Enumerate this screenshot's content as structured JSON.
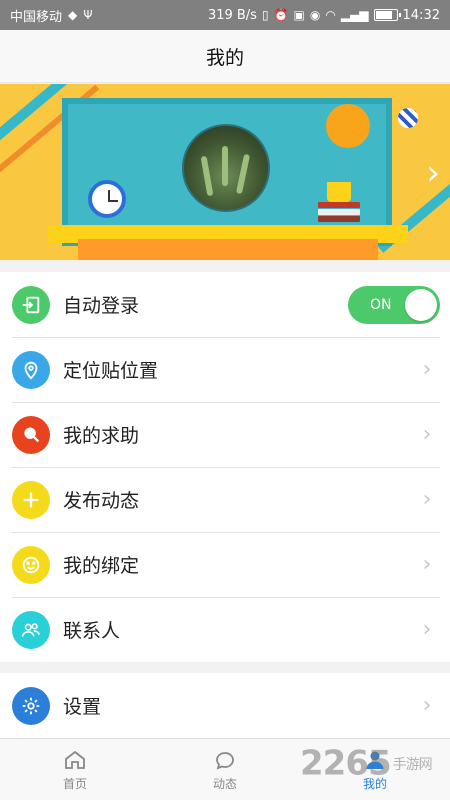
{
  "status_bar": {
    "carrier": "中国移动",
    "speed": "319 B/s",
    "time": "14:32",
    "battery_level": 0.85
  },
  "header": {
    "title": "我的"
  },
  "menu": [
    {
      "label": "自动登录",
      "icon": "login-icon",
      "color": "#4cc96a",
      "toggle_text": "ON",
      "toggle_on": true
    },
    {
      "label": "定位贴位置",
      "icon": "location-pin-icon",
      "color": "#3aa7e8"
    },
    {
      "label": "我的求助",
      "icon": "search-help-icon",
      "color": "#e8421e"
    },
    {
      "label": "发布动态",
      "icon": "plus-icon",
      "color": "#f5da1c"
    },
    {
      "label": "我的绑定",
      "icon": "smiley-icon",
      "color": "#f5da1c"
    },
    {
      "label": "联系人",
      "icon": "contacts-icon",
      "color": "#29d0d8"
    }
  ],
  "settings": {
    "label": "设置",
    "icon": "gear-icon",
    "color": "#2b7fd8"
  },
  "tabs": [
    {
      "label": "首页",
      "icon": "home-icon"
    },
    {
      "label": "动态",
      "icon": "chat-bubble-icon"
    },
    {
      "label": "我的",
      "icon": "person-icon",
      "active": true
    }
  ],
  "watermark": {
    "brand": "2265",
    "site": "手游网"
  }
}
